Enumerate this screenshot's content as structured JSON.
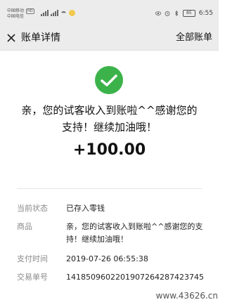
{
  "status_bar": {
    "carrier_1": "中国移动",
    "carrier_1_badge": "HD",
    "carrier_2": "中国电信",
    "battery": "85",
    "time": "6:55"
  },
  "nav": {
    "title": "账单详情",
    "right_action": "全部账单"
  },
  "bill": {
    "message": "亲，您的试客收入到账啦^^感谢您的支持！继续加油哦！",
    "amount": "+100.00",
    "accent_color": "#3cb34a"
  },
  "details": [
    {
      "label": "当前状态",
      "value": "已存入零钱"
    },
    {
      "label": "商品",
      "value": "亲，您的试客收入到账啦^^感谢您的支持！继续加油哦！"
    },
    {
      "label": "支付时间",
      "value": "2019-07-26 06:55:38"
    },
    {
      "label": "交易单号",
      "value": "1418509602201907264287423745"
    }
  ],
  "watermark": "www.43626.cn"
}
